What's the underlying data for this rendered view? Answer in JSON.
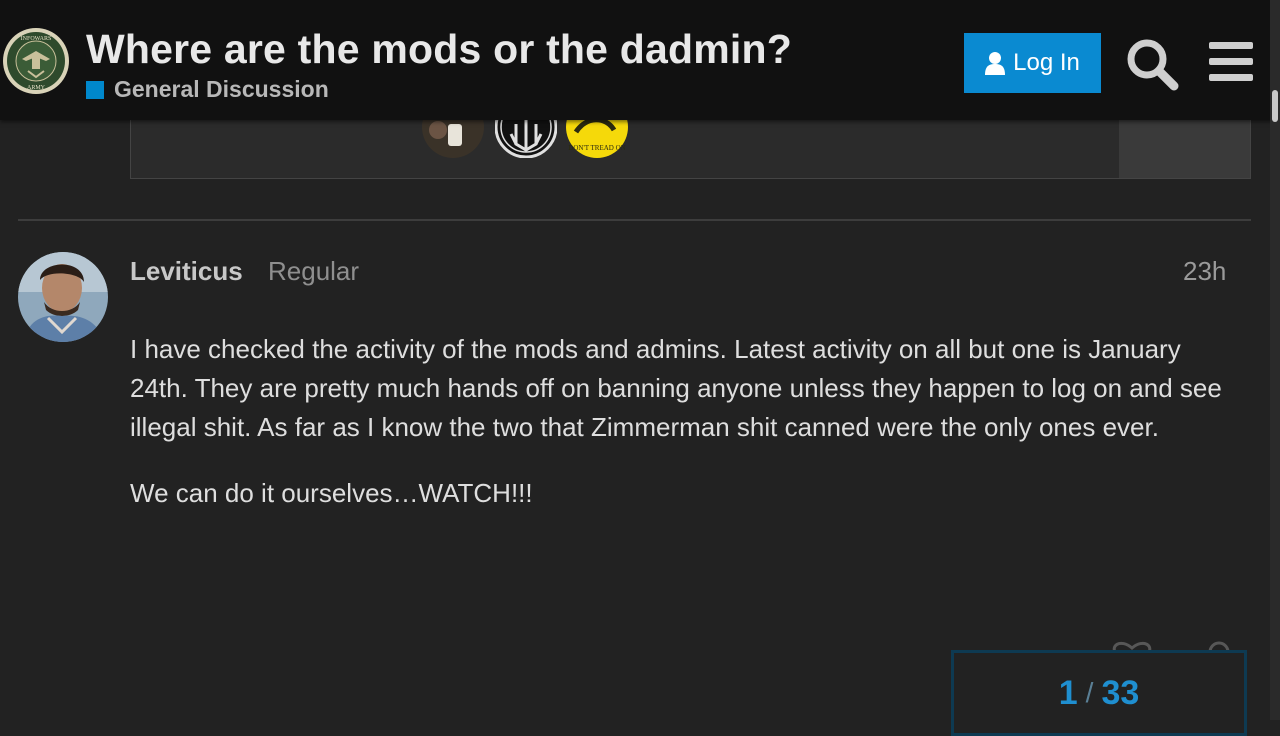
{
  "header": {
    "topic_title": "Where are the mods or the dadmin?",
    "category": "General Discussion",
    "category_color": "#0088cc",
    "login_label": "Log In",
    "logo_lettering": "INFOWARS ARMY"
  },
  "previous_post": {
    "participant_avatars": [
      "avatar-photo",
      "trident-emblem",
      "dont-tread-on-me-flag"
    ],
    "flag_text": "DON'T TREAD ON"
  },
  "post": {
    "username": "Leviticus",
    "user_title": "Regular",
    "date": "23h",
    "paragraphs": [
      "I have checked the activity of the mods and admins. Latest activity on all but one is January 24th. They are pretty much hands off on banning anyone unless they happen to log on and see illegal shit. As far as I know the two that Zimmerman shit canned were the only ones ever.",
      "We can do it ourselves…WATCH!!!"
    ]
  },
  "progress": {
    "current": "1",
    "separator": "/",
    "total": "33"
  },
  "colors": {
    "accent": "#0a8ad1",
    "background": "#222222",
    "header_bg": "#111111"
  }
}
